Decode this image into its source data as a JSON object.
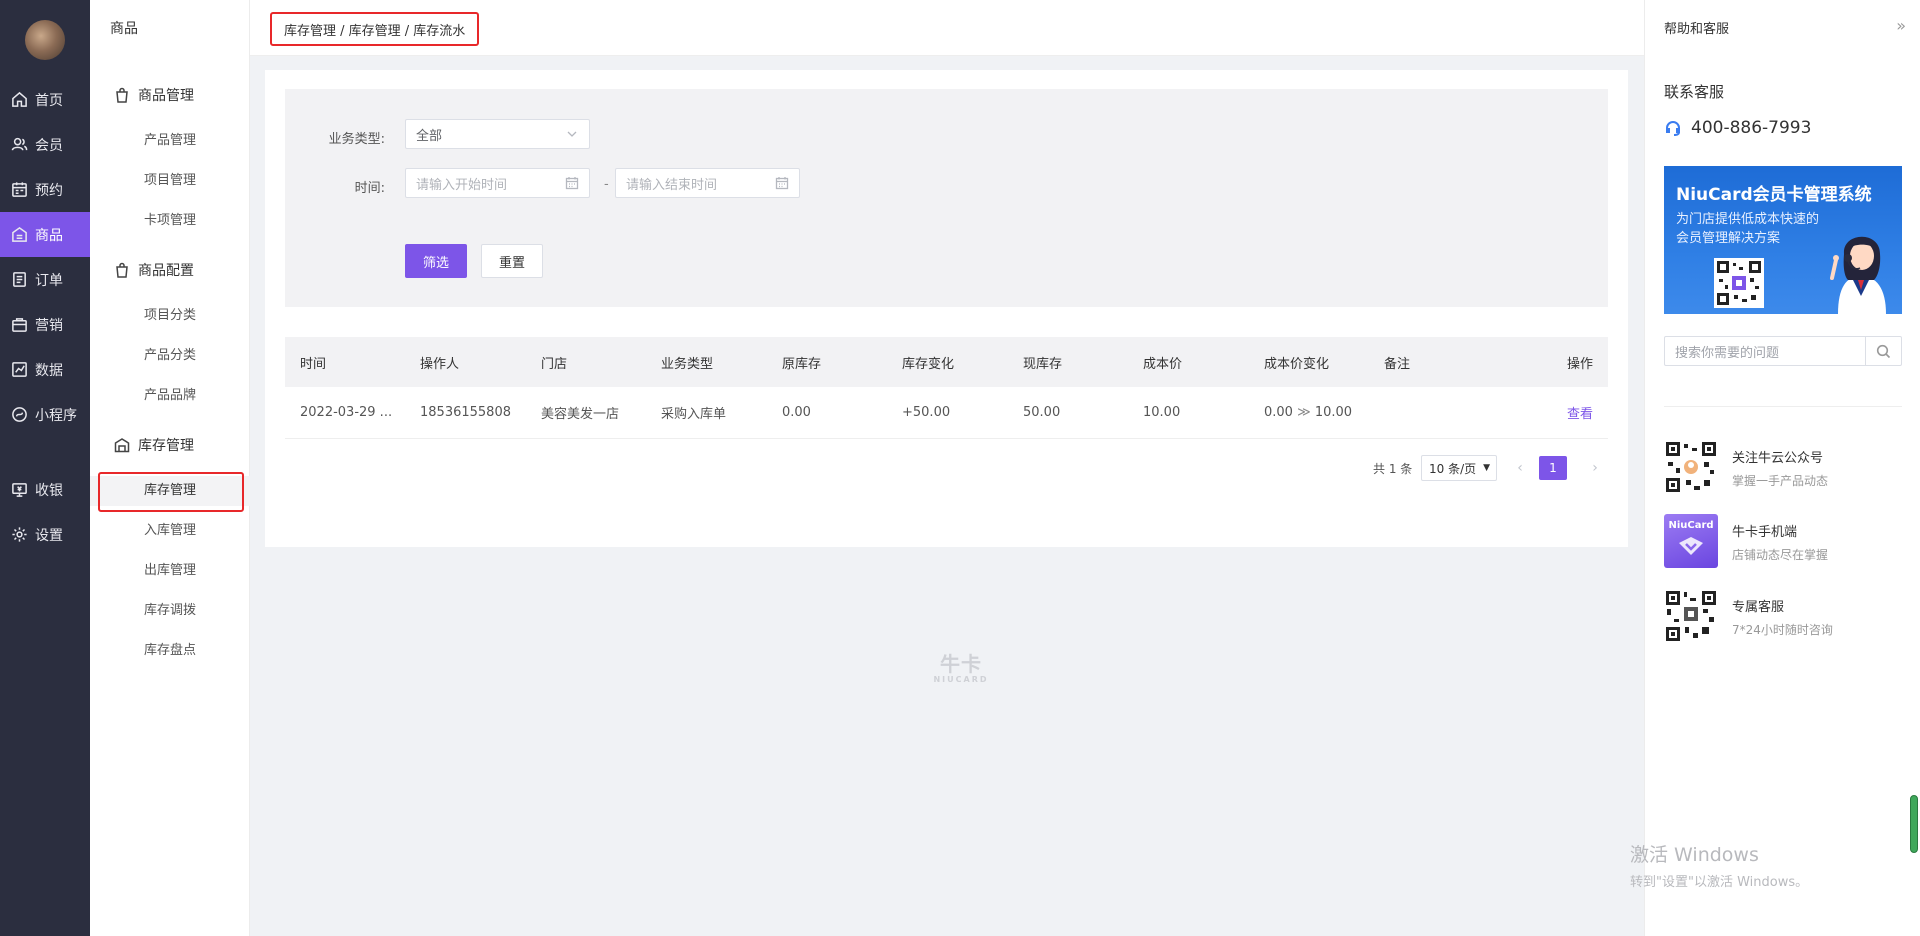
{
  "nav": {
    "items": [
      {
        "label": "首页",
        "icon": "home-icon"
      },
      {
        "label": "会员",
        "icon": "members-icon"
      },
      {
        "label": "预约",
        "icon": "calendar-icon"
      },
      {
        "label": "商品",
        "icon": "shop-icon",
        "active": true
      },
      {
        "label": "订单",
        "icon": "order-icon"
      },
      {
        "label": "营销",
        "icon": "marketing-icon"
      },
      {
        "label": "数据",
        "icon": "chart-icon"
      },
      {
        "label": "小程序",
        "icon": "miniapp-icon"
      },
      {
        "label": "收银",
        "icon": "cashier-icon"
      },
      {
        "label": "设置",
        "icon": "gear-icon"
      }
    ]
  },
  "subnav": {
    "title": "商品",
    "groups": [
      {
        "title": "商品管理",
        "items": [
          "产品管理",
          "项目管理",
          "卡项管理"
        ]
      },
      {
        "title": "商品配置",
        "items": [
          "项目分类",
          "产品分类",
          "产品品牌"
        ]
      },
      {
        "title": "库存管理",
        "items": [
          "库存管理",
          "入库管理",
          "出库管理",
          "库存调拨",
          "库存盘点"
        ]
      }
    ],
    "active_item": "库存管理"
  },
  "header": {
    "breadcrumb": "库存管理 / 库存管理 / 库存流水"
  },
  "filter": {
    "type_label": "业务类型:",
    "type_value": "全部",
    "time_label": "时间:",
    "start_placeholder": "请输入开始时间",
    "end_placeholder": "请输入结束时间",
    "separator": "-",
    "filter_button": "筛选",
    "reset_button": "重置"
  },
  "table": {
    "columns": [
      "时间",
      "操作人",
      "门店",
      "业务类型",
      "原库存",
      "库存变化",
      "现库存",
      "成本价",
      "成本价变化",
      "备注",
      "操作"
    ],
    "rows": [
      {
        "time": "2022-03-29 ...",
        "operator": "18536155808",
        "store": "美容美发一店",
        "biz_type": "采购入库单",
        "orig_stock": "0.00",
        "change": "+50.00",
        "current": "50.00",
        "cost": "10.00",
        "cost_from": "0.00",
        "cost_arrow": "≫",
        "cost_to": "10.00",
        "remark": "",
        "action": "查看"
      }
    ]
  },
  "pagination": {
    "total": "共 1 条",
    "page_size": "10 条/页",
    "current_page": "1",
    "prev": "‹",
    "next": "›"
  },
  "watermark": {
    "line1": "牛卡",
    "line2": "NIUCARD"
  },
  "help": {
    "title": "帮助和客服",
    "collapse": "»",
    "contact_title": "联系客服",
    "phone": "400-886-7993",
    "banner_title": "NiuCard会员卡管理系统",
    "banner_subtitle": "为门店提供低成本快速的会员管理解决方案",
    "search_placeholder": "搜索你需要的问题",
    "promos": [
      {
        "title": "关注牛云公众号",
        "subtitle": "掌握一手产品动态"
      },
      {
        "title": "牛卡手机端",
        "subtitle": "店铺动态尽在掌握",
        "badge": "NiuCard"
      },
      {
        "title": "专属客服",
        "subtitle": "7*24小时随时咨询"
      }
    ]
  },
  "windows_watermark": {
    "line1": "激活 Windows",
    "line2": "转到\"设置\"以激活 Windows。"
  },
  "colors": {
    "accent": "#7d55e8",
    "nav_bg": "#2b2e3f",
    "highlight_outline": "#e8282a"
  }
}
